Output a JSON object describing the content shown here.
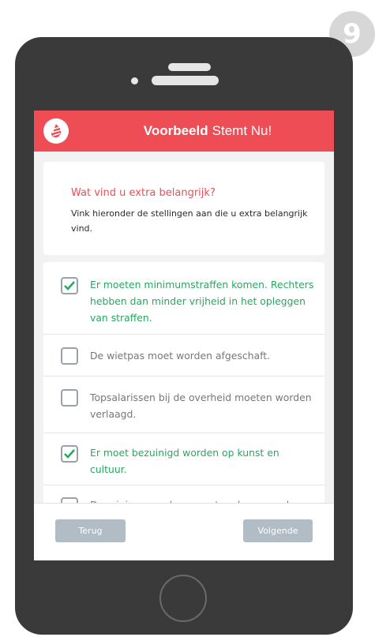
{
  "step": {
    "number": "9"
  },
  "header": {
    "title_bold": "Voorbeeld",
    "title_rest": "Stemt Nu!",
    "accent_color": "#ef4d55",
    "logo_icon": "flame-logo-icon"
  },
  "intro": {
    "title": "Wat vind u extra belangrijk?",
    "subtitle": "Vink hieronder de stellingen aan die u extra belangrijk vind."
  },
  "statements": [
    {
      "text": "Er moeten minimumstraffen komen. Rechters hebben dan minder vrijheid in het opleggen van straffen.",
      "checked": true
    },
    {
      "text": "De wietpas moet worden afgeschaft.",
      "checked": false
    },
    {
      "text": "Topsalarissen bij de overheid moeten worden verlaagd.",
      "checked": false
    },
    {
      "text": "Er moet bezuinigd worden op kunst en cultuur.",
      "checked": true
    },
    {
      "text": "De minimumuurloon moet omhoog worden verhoogd.",
      "checked": false
    }
  ],
  "footer": {
    "back_label": "Terug",
    "next_label": "Volgende"
  },
  "colors": {
    "checked_text": "#27a860",
    "unchecked_text": "#777777",
    "button_bg": "#b2bcc5"
  }
}
